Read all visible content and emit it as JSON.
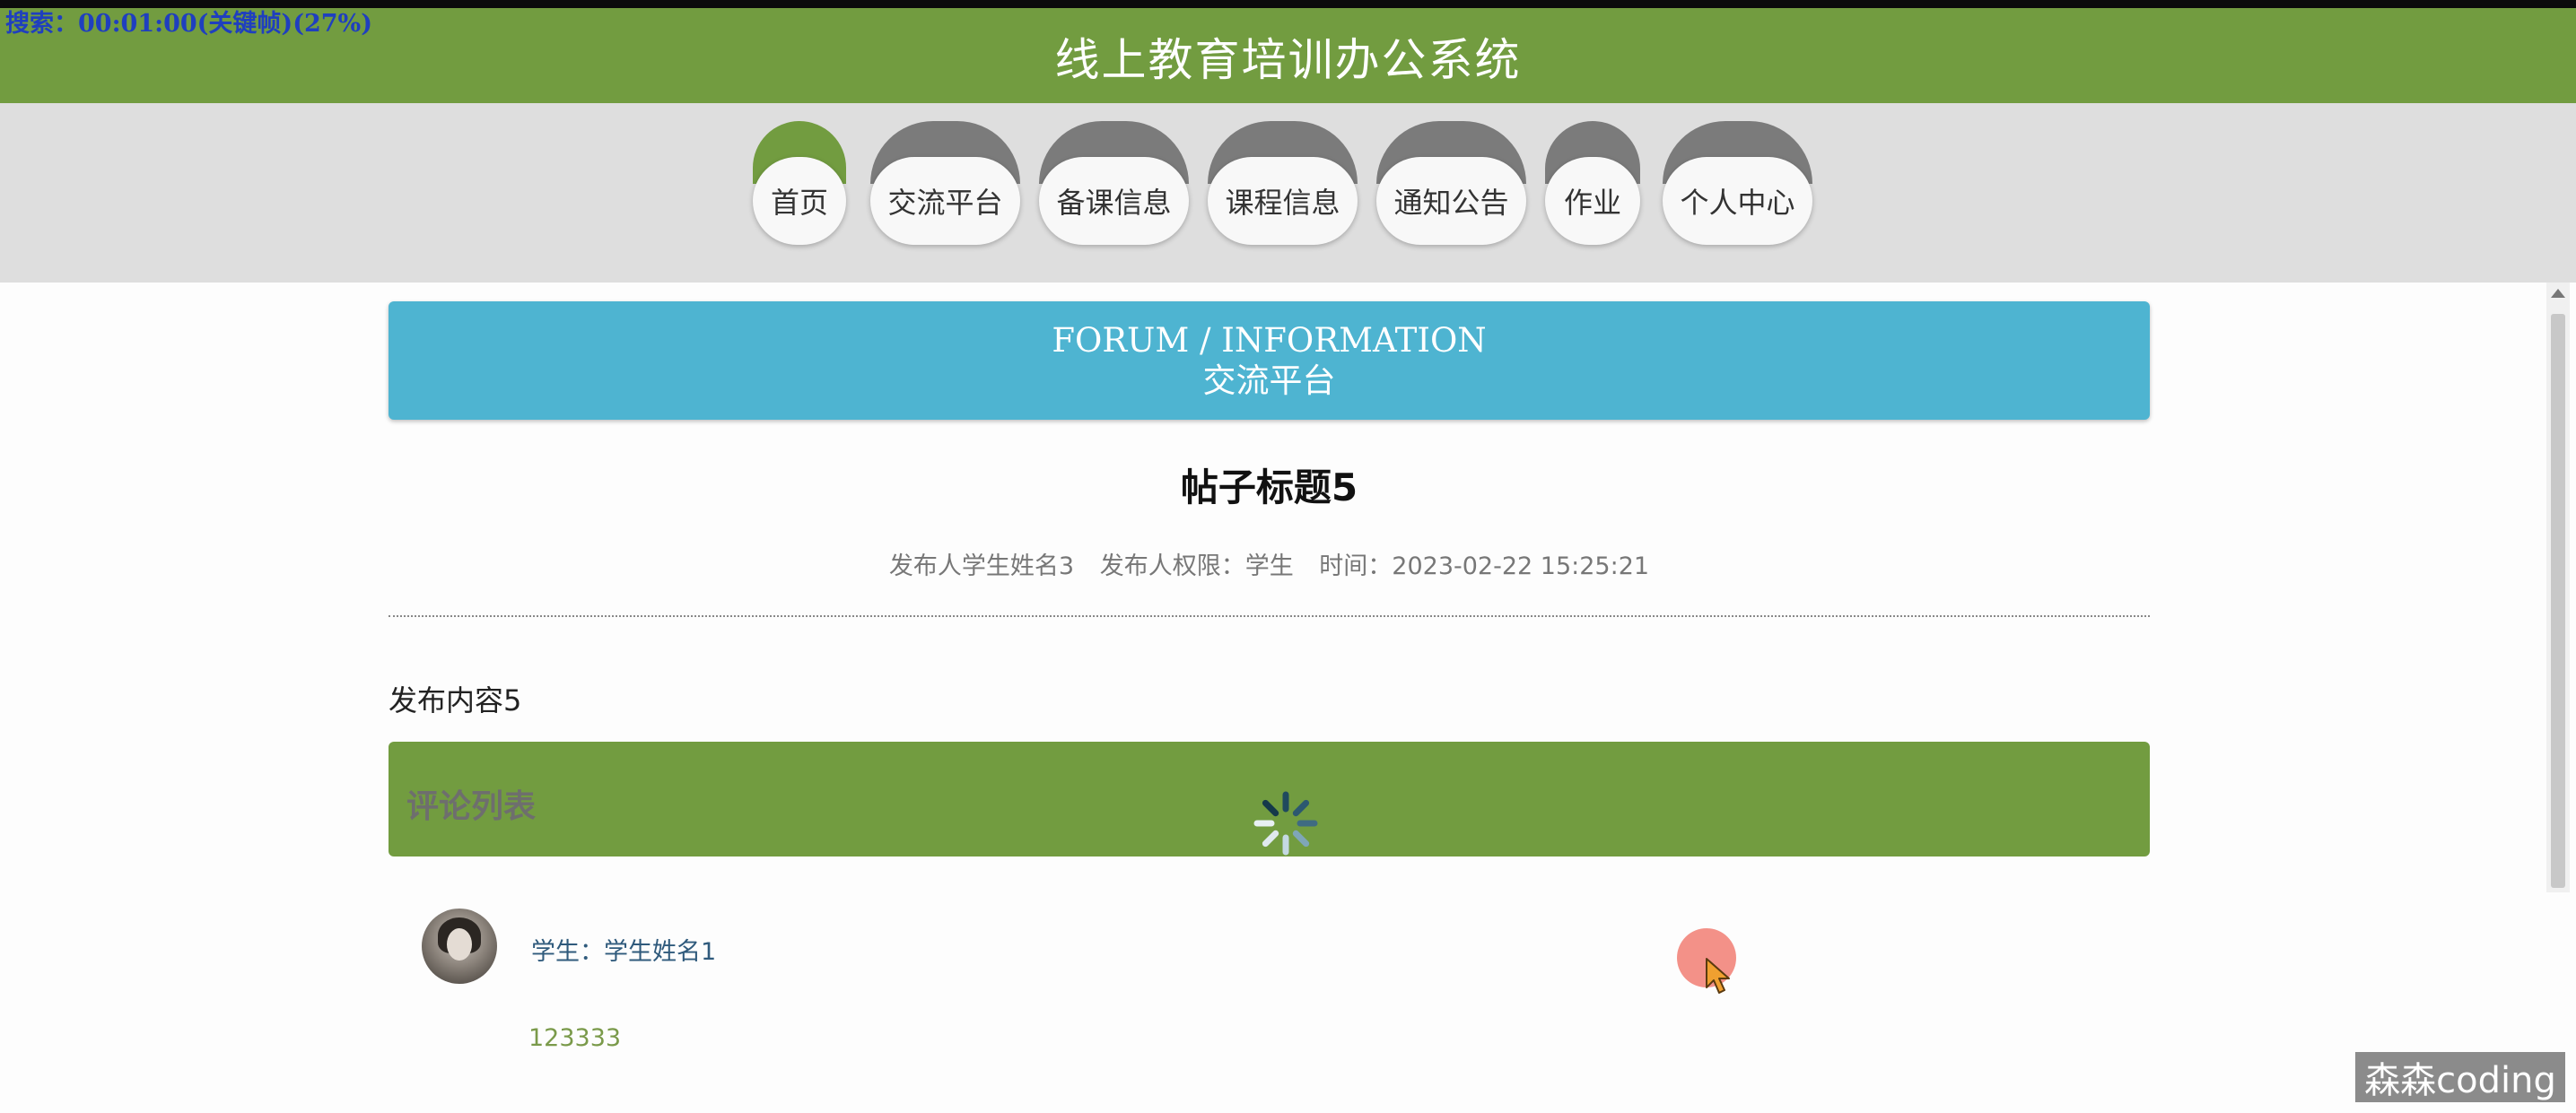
{
  "overlay": {
    "text": "搜索：00:01:00(关键帧)(27%)"
  },
  "header": {
    "title": "线上教育培训办公系统"
  },
  "nav": {
    "items": [
      {
        "label": "首页"
      },
      {
        "label": "交流平台"
      },
      {
        "label": "备课信息"
      },
      {
        "label": "课程信息"
      },
      {
        "label": "通知公告"
      },
      {
        "label": "作业"
      },
      {
        "label": "个人中心"
      }
    ]
  },
  "banner": {
    "en": "FORUM / INFORMATION",
    "cn": "交流平台"
  },
  "post": {
    "title": "帖子标题5",
    "author": "发布人学生姓名3",
    "role": "发布人权限：学生",
    "time": "时间：2023-02-22 15:25:21",
    "content": "发布内容5"
  },
  "comments": {
    "heading": "评论列表",
    "items": [
      {
        "author": "学生：学生姓名1",
        "text": "123333"
      }
    ]
  },
  "watermark": {
    "text": "森森coding"
  },
  "colors": {
    "green": "#729c40",
    "blue": "#4eb4d1",
    "nav_cap": "#7b7b7b"
  },
  "icons": {
    "loading": "loading-spinner-icon",
    "cursor": "mouse-cursor-icon"
  }
}
